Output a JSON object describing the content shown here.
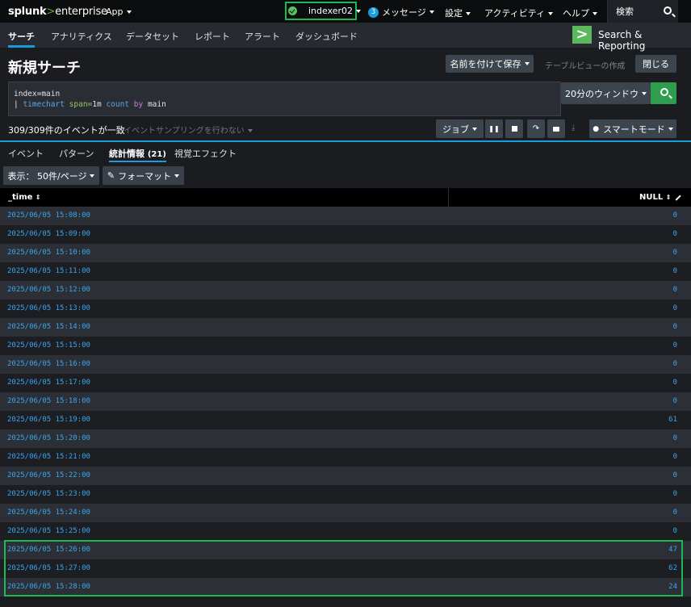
{
  "topbar": {
    "logo_prefix": "splunk",
    "logo_gt": ">",
    "logo_suffix": "enterprise",
    "app_menu": "App",
    "server": "indexer02",
    "messages_count": "3",
    "messages": "メッセージ",
    "settings": "設定",
    "activity": "アクティビティ",
    "help": "ヘルプ",
    "search": "検索"
  },
  "appbar": {
    "items": [
      "サーチ",
      "アナリティクス",
      "データセット",
      "レポート",
      "アラート",
      "ダッシュボード"
    ],
    "app_title": "Search & Reporting"
  },
  "header": {
    "title": "新規サーチ",
    "save_as": "名前を付けて保存",
    "table_view": "テーブルビューの作成",
    "close": "閉じる"
  },
  "search": {
    "line1": "index=main",
    "pipe": "| ",
    "cmd": "timechart",
    "arg_key": " span=",
    "arg_val": "1m",
    "func": " count",
    "by": " by",
    "field": " main",
    "time_range": "20分のウィンドウ"
  },
  "status": {
    "events": "309/309件のイベントが一致",
    "sampling": "イベントサンプリングを行わない",
    "job": "ジョブ",
    "mode": "スマートモード"
  },
  "tabs": {
    "events": "イベント",
    "patterns": "パターン",
    "stats": "統計情報",
    "stats_count": "(21)",
    "viz": "視覚エフェクト"
  },
  "options": {
    "display": "表示： 50件/ページ",
    "format": "フォーマット"
  },
  "table": {
    "columns": [
      "_time",
      "NULL"
    ],
    "rows": [
      [
        "2025/06/05 15:08:00",
        "0"
      ],
      [
        "2025/06/05 15:09:00",
        "0"
      ],
      [
        "2025/06/05 15:10:00",
        "0"
      ],
      [
        "2025/06/05 15:11:00",
        "0"
      ],
      [
        "2025/06/05 15:12:00",
        "0"
      ],
      [
        "2025/06/05 15:13:00",
        "0"
      ],
      [
        "2025/06/05 15:14:00",
        "0"
      ],
      [
        "2025/06/05 15:15:00",
        "0"
      ],
      [
        "2025/06/05 15:16:00",
        "0"
      ],
      [
        "2025/06/05 15:17:00",
        "0"
      ],
      [
        "2025/06/05 15:18:00",
        "0"
      ],
      [
        "2025/06/05 15:19:00",
        "61"
      ],
      [
        "2025/06/05 15:20:00",
        "0"
      ],
      [
        "2025/06/05 15:21:00",
        "0"
      ],
      [
        "2025/06/05 15:22:00",
        "0"
      ],
      [
        "2025/06/05 15:23:00",
        "0"
      ],
      [
        "2025/06/05 15:24:00",
        "0"
      ],
      [
        "2025/06/05 15:25:00",
        "0"
      ],
      [
        "2025/06/05 15:26:00",
        "47"
      ],
      [
        "2025/06/05 15:27:00",
        "62"
      ],
      [
        "2025/06/05 15:28:00",
        "24"
      ]
    ]
  },
  "colors": {
    "accent": "#1a9cdb",
    "highlight": "#1db954",
    "go": "#2e9e4e"
  }
}
